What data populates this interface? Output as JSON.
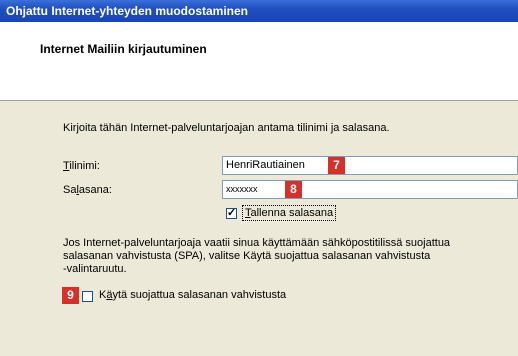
{
  "window": {
    "title": "Ohjattu Internet-yhteyden muodostaminen"
  },
  "header": {
    "title": "Internet Mailiin kirjautuminen"
  },
  "main": {
    "instruction": "Kirjoita tähän Internet-palveluntarjoajan antama tilinimi ja salasana.",
    "username_label_mnemonic": "T",
    "username_label_rest": "ilinimi:",
    "username_value": "HenriRautiainen",
    "password_label_pre": "Sa",
    "password_label_mnemonic": "l",
    "password_label_post": "asana:",
    "password_value": "xxxxxxx",
    "save_password_mnemonic": "T",
    "save_password_rest": "allenna salasana",
    "save_password_checked": true,
    "spa_description_line1": "Jos Internet-palveluntarjoaja vaatii sinua käyttämään sähköpostitilissä suojattua",
    "spa_description_line2": "salasanan vahvistusta (SPA), valitse Käytä suojattua salasanan vahvistusta",
    "spa_description_line3": "-valintaruutu.",
    "spa_label_pre": "K",
    "spa_label_mnemonic": "ä",
    "spa_label_post": "ytä suojattua salasanan vahvistusta",
    "spa_checked": false
  },
  "annotations": {
    "badge_7": "7",
    "badge_8": "8",
    "badge_9": "9",
    "badge_color": "#d6302b"
  }
}
